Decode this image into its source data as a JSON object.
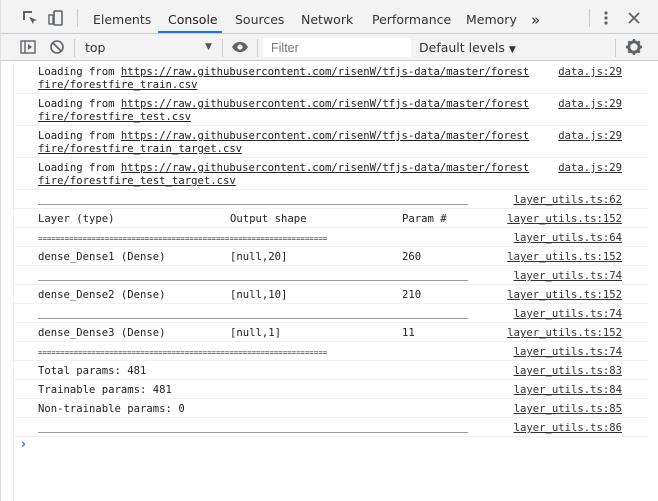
{
  "tabs": [
    "Elements",
    "Console",
    "Sources",
    "Network",
    "Performance",
    "Memory"
  ],
  "more_tabs_glyph": "»",
  "toolbar": {
    "context": "top",
    "filter_placeholder": "Filter",
    "levels": "Default levels"
  },
  "icons": {
    "inspect": "inspect-element-icon",
    "device": "device-toolbar-icon",
    "menu": "kebab-menu-icon",
    "close": "close-icon",
    "sidebar": "console-sidebar-icon",
    "clear": "clear-console-icon",
    "eye": "live-expression-eye-icon",
    "settings": "gear-icon",
    "prompt": "chevron-prompt-icon"
  },
  "console": {
    "loads": [
      {
        "prefix": "Loading from ",
        "url1": "https://raw.githubusercontent.com/risenW/tfjs-data/master/forest",
        "url2": "fire/forestfire_train.csv",
        "source": "data.js:29"
      },
      {
        "prefix": "Loading from ",
        "url1": "https://raw.githubusercontent.com/risenW/tfjs-data/master/forest",
        "url2": "fire/forestfire_test.csv",
        "source": "data.js:29"
      },
      {
        "prefix": "Loading from ",
        "url1": "https://raw.githubusercontent.com/risenW/tfjs-data/master/forest",
        "url2": "fire/forestfire_train_target.csv",
        "source": "data.js:29"
      },
      {
        "prefix": "Loading from ",
        "url1": "https://raw.githubusercontent.com/risenW/tfjs-data/master/forest",
        "url2": "fire/forestfire_test_target.csv",
        "source": "data.js:29"
      }
    ],
    "summary": [
      {
        "kind": "rule",
        "source": "layer_utils.ts:62"
      },
      {
        "kind": "cols",
        "c1": "Layer (type)",
        "c2": "Output shape",
        "c3": "Param #",
        "source": "layer_utils.ts:152"
      },
      {
        "kind": "text",
        "text": "=================================================================",
        "source": "layer_utils.ts:64"
      },
      {
        "kind": "cols",
        "c1": "dense_Dense1 (Dense)",
        "c2": "[null,20]",
        "c3": "260",
        "source": "layer_utils.ts:152"
      },
      {
        "kind": "rule",
        "source": "layer_utils.ts:74"
      },
      {
        "kind": "cols",
        "c1": "dense_Dense2 (Dense)",
        "c2": "[null,10]",
        "c3": "210",
        "source": "layer_utils.ts:152"
      },
      {
        "kind": "rule",
        "source": "layer_utils.ts:74"
      },
      {
        "kind": "cols",
        "c1": "dense_Dense3 (Dense)",
        "c2": "[null,1]",
        "c3": "11",
        "source": "layer_utils.ts:152"
      },
      {
        "kind": "text",
        "text": "=================================================================",
        "source": "layer_utils.ts:74"
      },
      {
        "kind": "text",
        "text": "Total params: 481",
        "source": "layer_utils.ts:83"
      },
      {
        "kind": "text",
        "text": "Trainable params: 481",
        "source": "layer_utils.ts:84"
      },
      {
        "kind": "text",
        "text": "Non-trainable params: 0",
        "source": "layer_utils.ts:85"
      },
      {
        "kind": "rule",
        "source": "layer_utils.ts:86"
      }
    ],
    "prompt_glyph": "›"
  }
}
